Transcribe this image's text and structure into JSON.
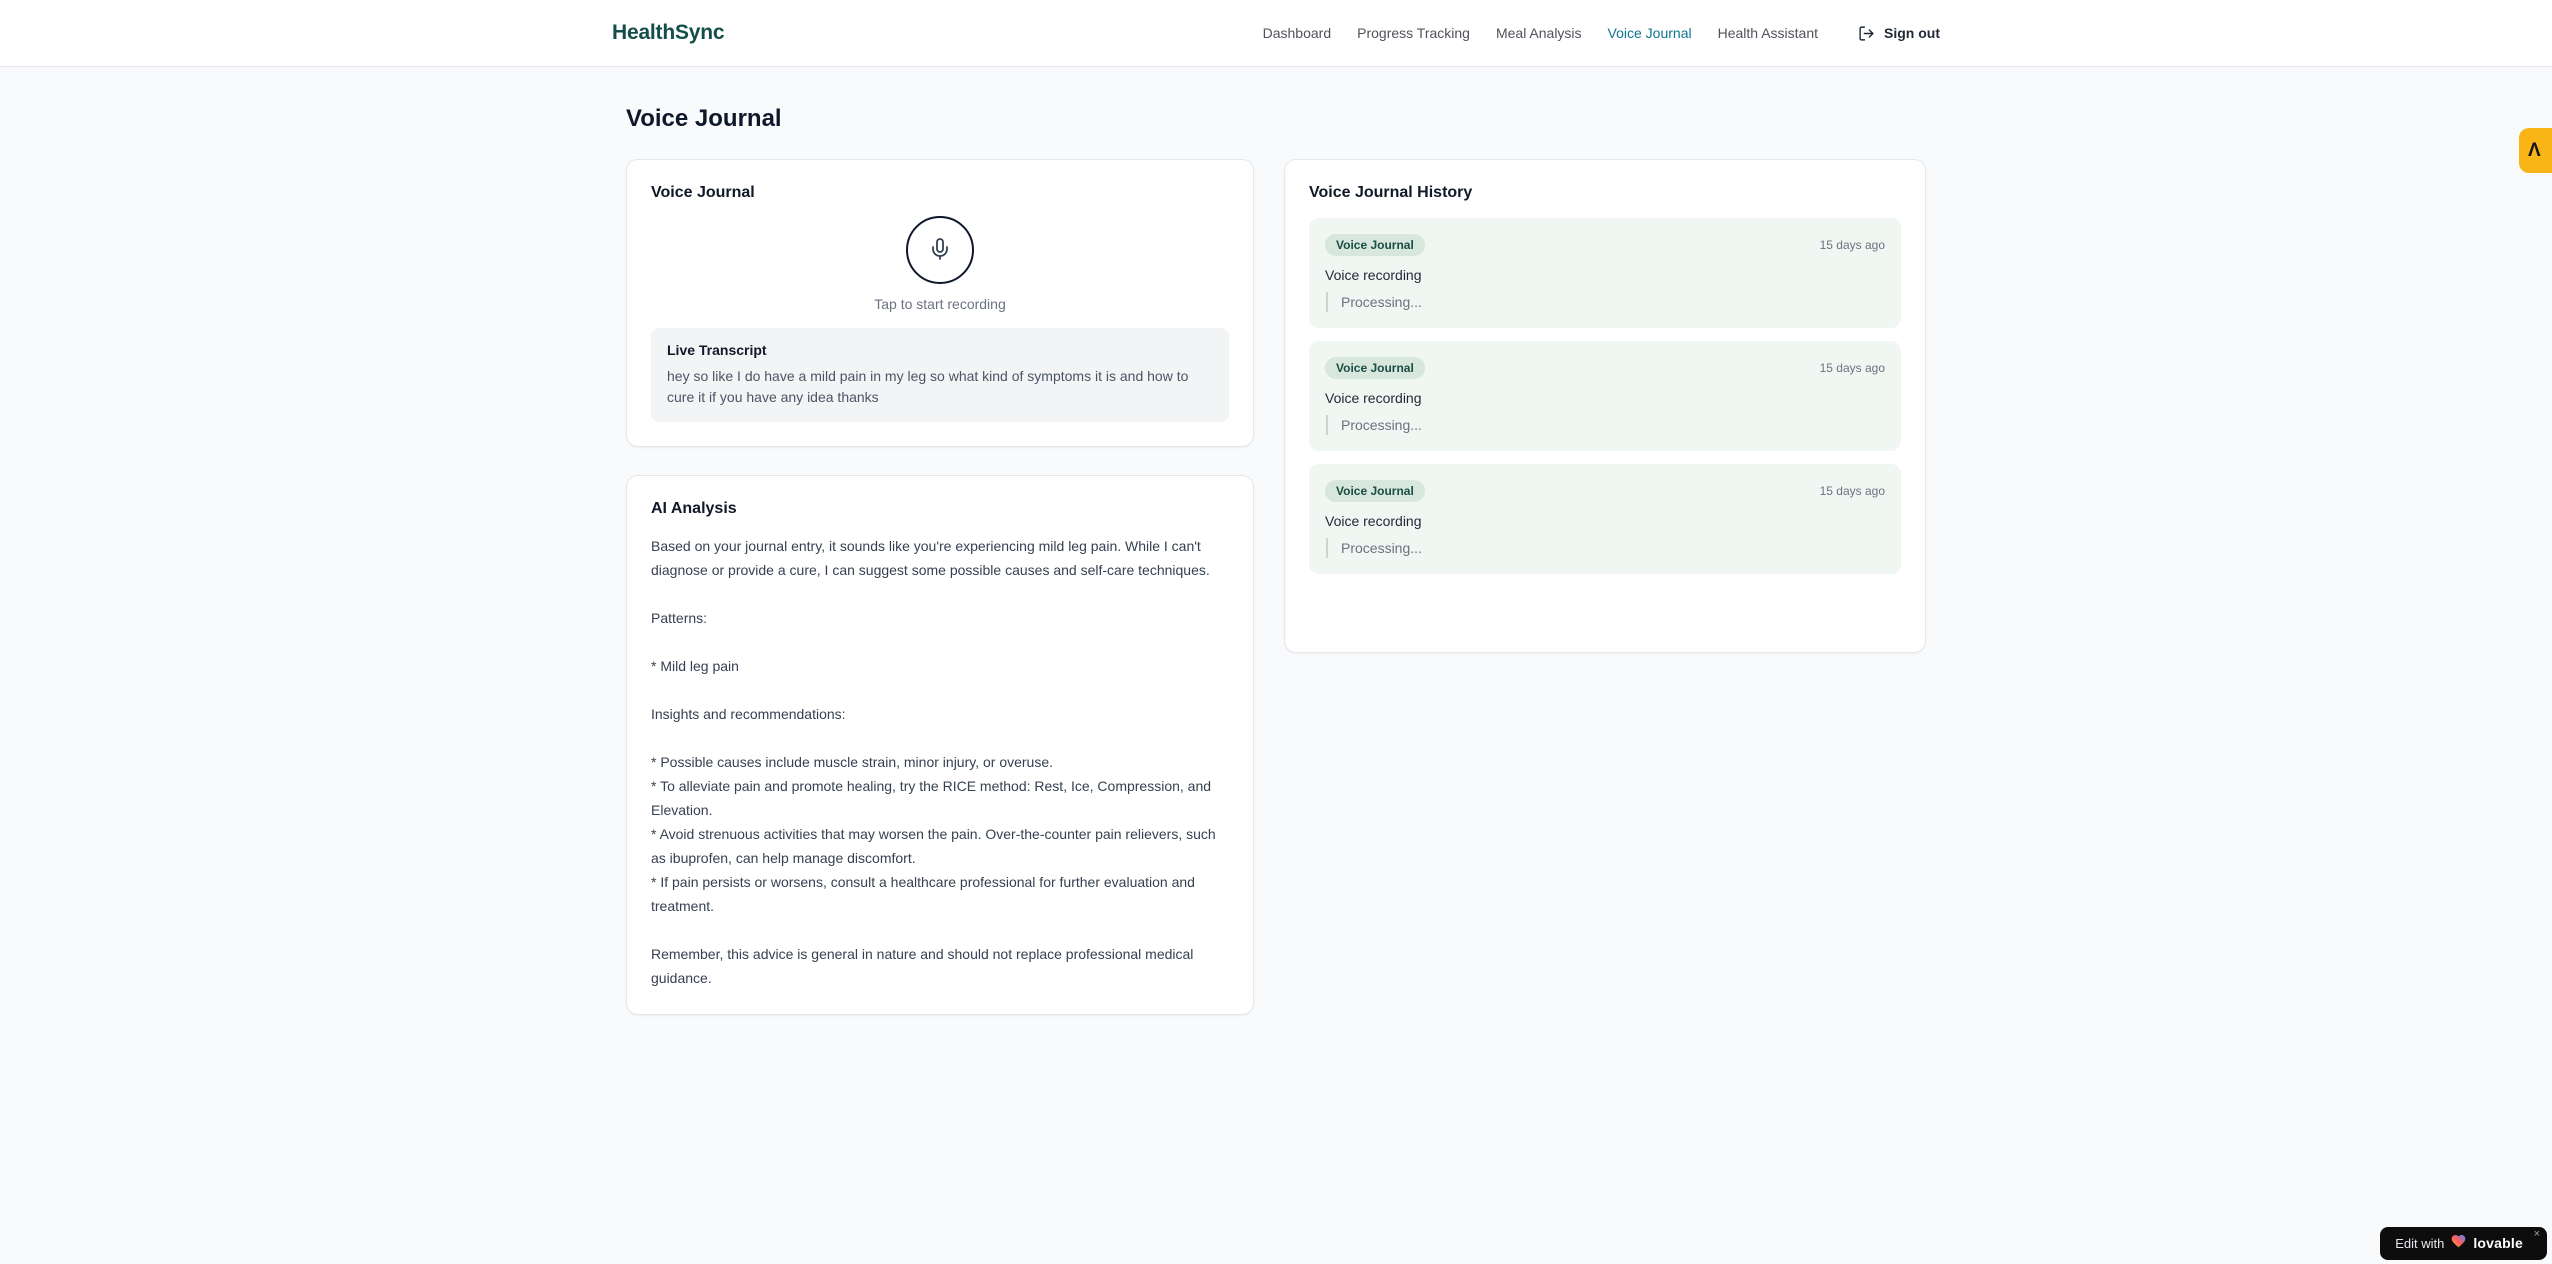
{
  "brand": {
    "name": "HealthSync"
  },
  "nav": {
    "items": [
      {
        "label": "Dashboard",
        "active": false
      },
      {
        "label": "Progress Tracking",
        "active": false
      },
      {
        "label": "Meal Analysis",
        "active": false
      },
      {
        "label": "Voice Journal",
        "active": true
      },
      {
        "label": "Health Assistant",
        "active": false
      }
    ],
    "signout_label": "Sign out"
  },
  "page": {
    "title": "Voice Journal"
  },
  "recorder": {
    "card_title": "Voice Journal",
    "tap_hint": "Tap to start recording",
    "transcript_title": "Live Transcript",
    "transcript_text": "hey so like I do have a mild pain in my leg so what kind of symptoms it is and how to cure it if you have any idea thanks"
  },
  "analysis": {
    "card_title": "AI Analysis",
    "body": "Based on your journal entry, it sounds like you're experiencing mild leg pain. While I can't diagnose or provide a cure, I can suggest some possible causes and self-care techniques.\n\nPatterns:\n\n* Mild leg pain\n\nInsights and recommendations:\n\n* Possible causes include muscle strain, minor injury, or overuse.\n* To alleviate pain and promote healing, try the RICE method: Rest, Ice, Compression, and Elevation.\n* Avoid strenuous activities that may worsen the pain. Over-the-counter pain relievers, such as ibuprofen, can help manage discomfort.\n* If pain persists or worsens, consult a healthcare professional for further evaluation and treatment.\n\nRemember, this advice is general in nature and should not replace professional medical guidance."
  },
  "history": {
    "card_title": "Voice Journal History",
    "entries": [
      {
        "badge": "Voice Journal",
        "time": "15 days ago",
        "title": "Voice recording",
        "status": "Processing..."
      },
      {
        "badge": "Voice Journal",
        "time": "15 days ago",
        "title": "Voice recording",
        "status": "Processing..."
      },
      {
        "badge": "Voice Journal",
        "time": "15 days ago",
        "title": "Voice recording",
        "status": "Processing..."
      }
    ]
  },
  "widgets": {
    "side_button_glyph": "Λ",
    "lovable": {
      "prefix": "Edit with",
      "brand": "lovable",
      "close": "×"
    }
  },
  "colors": {
    "brand_text": "#134e4a",
    "nav_active": "#0e7490",
    "entry_bg": "#f0f6f2",
    "badge_bg": "#d7e7de",
    "badge_text": "#1b4d42",
    "side_button_bg": "#f9b416",
    "lovable_bg": "#0d0d0e"
  }
}
